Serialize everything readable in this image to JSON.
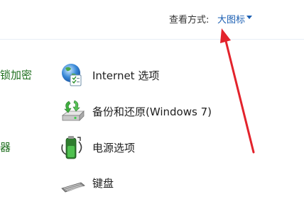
{
  "header": {
    "view_by_label": "查看方式:",
    "view_by_value": "大图标"
  },
  "left_partial_items": [
    {
      "label": "锁加密"
    },
    {
      "label": "器"
    }
  ],
  "items": [
    {
      "label": "Internet 选项",
      "icon": "internet-options-icon"
    },
    {
      "label": "备份和还原(Windows 7)",
      "icon": "backup-restore-icon"
    },
    {
      "label": "电源选项",
      "icon": "power-options-icon"
    },
    {
      "label": "键盘",
      "icon": "keyboard-icon"
    }
  ],
  "annotation": {
    "color": "#e3232c"
  }
}
